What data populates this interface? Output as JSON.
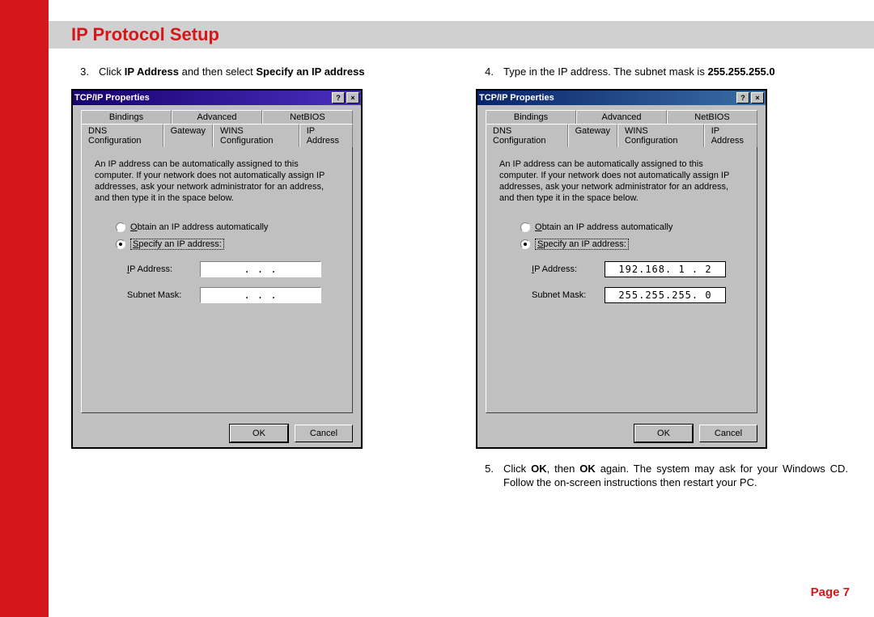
{
  "page": {
    "title": "IP Protocol Setup",
    "page_label": "Page 7"
  },
  "steps": {
    "s3": {
      "num": "3.",
      "text_a": "Click ",
      "b1": "IP Address",
      "text_b": " and then select ",
      "b2": "Specify an IP address"
    },
    "s4": {
      "num": "4.",
      "text_a": "Type in the IP address. The subnet mask is ",
      "b1": "255.255.255.0"
    },
    "s5": {
      "num": "5.",
      "text_a": "Click ",
      "b1": "OK",
      "text_b": ", then ",
      "b2": "OK",
      "text_c": " again. The system may ask for your Windows CD. Follow the on-screen instructions then restart your PC."
    }
  },
  "dialog": {
    "title": "TCP/IP Properties",
    "help_icon": "?",
    "close_icon": "×",
    "tabs_row1": [
      "Bindings",
      "Advanced",
      "NetBIOS"
    ],
    "tabs_row2": [
      "DNS Configuration",
      "Gateway",
      "WINS Configuration",
      "IP Address"
    ],
    "desc": "An IP address can be automatically assigned to this computer. If your network does not automatically assign IP addresses, ask your network administrator for an address, and then type it in the space below.",
    "radio_obtain_pre": "O",
    "radio_obtain_rest": "btain an IP address automatically",
    "radio_specify_pre": "S",
    "radio_specify_rest": "pecify an IP address:",
    "ip_label_pre": "I",
    "ip_label_rest": "P Address:",
    "subnet_label_pre": "S",
    "subnet_label_rest": "ubnet Mask:",
    "ok_label": "OK",
    "cancel_label": "Cancel",
    "left": {
      "ip_value": ".   .   .",
      "subnet_value": ".   .   ."
    },
    "right": {
      "ip_value": "192.168. 1 . 2",
      "subnet_value": "255.255.255. 0"
    }
  }
}
